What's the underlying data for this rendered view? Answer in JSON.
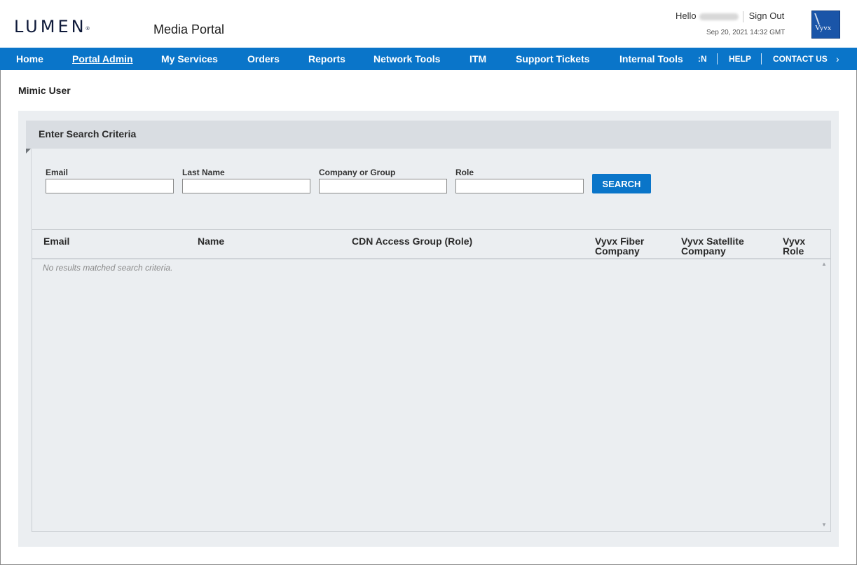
{
  "header": {
    "logo": "LUMEN",
    "logo_mark": "®",
    "portal_title": "Media Portal",
    "greeting": "Hello",
    "sign_out": "Sign Out",
    "timestamp": "Sep 20, 2021 14:32 GMT",
    "partner_logo": "Vyvx"
  },
  "nav": {
    "items": [
      {
        "label": "Home"
      },
      {
        "label": "Portal Admin",
        "active": true
      },
      {
        "label": "My Services"
      },
      {
        "label": "Orders"
      },
      {
        "label": "Reports"
      },
      {
        "label": "Network Tools"
      },
      {
        "label": "ITM"
      },
      {
        "label": "Support Tickets"
      },
      {
        "label": "Internal Tools"
      }
    ],
    "truncated": ":N",
    "help": "HELP",
    "contact": "CONTACT US",
    "chevron": "›",
    "color": "#0a75c9"
  },
  "page": {
    "title": "Mimic User"
  },
  "search": {
    "panel_title": "Enter Search Criteria",
    "fields": [
      {
        "label": "Email",
        "value": ""
      },
      {
        "label": "Last Name",
        "value": ""
      },
      {
        "label": "Company or Group",
        "value": ""
      },
      {
        "label": "Role",
        "value": ""
      }
    ],
    "button": "SEARCH"
  },
  "results": {
    "columns": [
      {
        "line1": "Email",
        "line2": ""
      },
      {
        "line1": "Name",
        "line2": ""
      },
      {
        "line1": "CDN Access Group (Role)",
        "line2": ""
      },
      {
        "line1": "Vyvx Fiber",
        "line2": "Company"
      },
      {
        "line1": "Vyvx Satellite",
        "line2": "Company"
      },
      {
        "line1": "Vyvx",
        "line2": "Role"
      }
    ],
    "empty_message": "No results matched search criteria.",
    "scroll_up": "▲",
    "scroll_down": "▼"
  }
}
